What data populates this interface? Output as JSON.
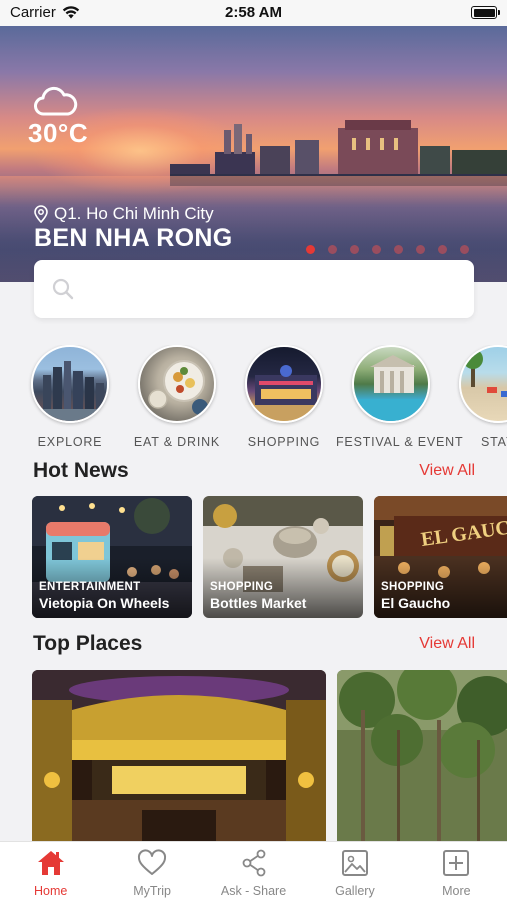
{
  "status_bar": {
    "carrier": "Carrier",
    "time": "2:58 AM"
  },
  "hero": {
    "weather_icon": "cloud-icon",
    "temperature": "30°C",
    "location": "Q1. Ho Chi Minh City",
    "place_name": "BEN NHA RONG",
    "slide_count": 8,
    "active_slide": 1
  },
  "search": {
    "placeholder": ""
  },
  "categories": [
    {
      "label": "EXPLORE",
      "icon": "city-skyline-photo"
    },
    {
      "label": "EAT & DRINK",
      "icon": "food-plate-photo"
    },
    {
      "label": "SHOPPING",
      "icon": "shopping-mall-photo"
    },
    {
      "label": "FESTIVAL & EVENT",
      "icon": "festival-pool-photo"
    },
    {
      "label": "STAY",
      "icon": "beach-stay-photo"
    }
  ],
  "hot_news": {
    "title": "Hot News",
    "view_all": "View All",
    "items": [
      {
        "category": "ENTERTAINMENT",
        "title": "Vietopia On Wheels"
      },
      {
        "category": "SHOPPING",
        "title": "Bottles Market"
      },
      {
        "category": "SHOPPING",
        "title": "El Gaucho"
      }
    ]
  },
  "top_places": {
    "title": "Top Places",
    "view_all": "View All",
    "items": [
      {
        "image": "theater-interior-photo"
      },
      {
        "image": "mangrove-forest-photo"
      }
    ]
  },
  "tab_bar": [
    {
      "label": "Home",
      "icon": "home-icon",
      "active": true
    },
    {
      "label": "MyTrip",
      "icon": "heart-icon",
      "active": false
    },
    {
      "label": "Ask - Share",
      "icon": "share-icon",
      "active": false
    },
    {
      "label": "Gallery",
      "icon": "image-icon",
      "active": false
    },
    {
      "label": "More",
      "icon": "plus-square-icon",
      "active": false
    }
  ],
  "colors": {
    "accent": "#e53935",
    "background": "#f2f2f4",
    "tab_inactive": "#888888"
  }
}
